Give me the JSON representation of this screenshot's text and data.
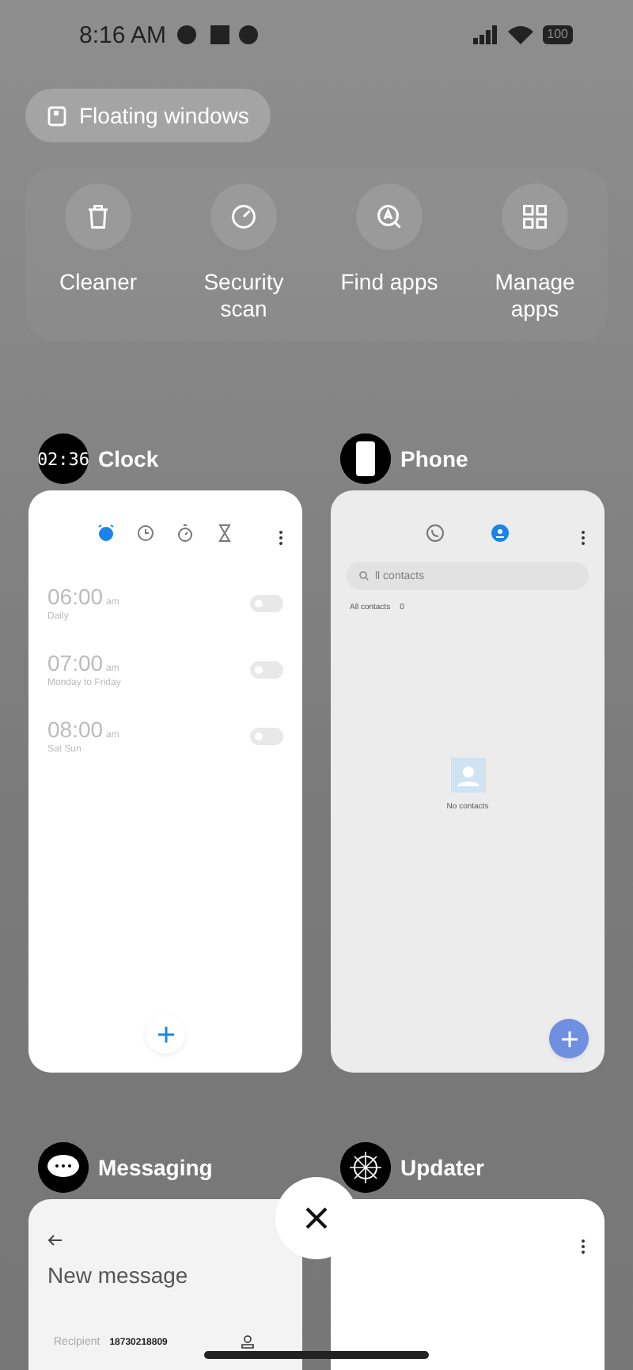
{
  "status_bar": {
    "time": "8:16 AM",
    "battery": "100"
  },
  "floating_button": {
    "label": "Floating windows"
  },
  "quick_actions": [
    {
      "label": "Cleaner",
      "kind": "trash"
    },
    {
      "label": "Security scan",
      "kind": "gauge"
    },
    {
      "label": "Find apps",
      "kind": "find"
    },
    {
      "label": "Manage apps",
      "kind": "grid"
    }
  ],
  "recent_apps": [
    {
      "kind": "clock",
      "name": "Clock",
      "icon_text": "02:36",
      "tabs": [
        {
          "kind": "alarm",
          "selected": true
        },
        {
          "kind": "clock",
          "selected": false
        },
        {
          "kind": "stopwatch",
          "selected": false
        },
        {
          "kind": "timer",
          "selected": false
        }
      ],
      "alarms": [
        {
          "time": "06:00",
          "suffix": "am",
          "repeat": "Daily",
          "on": false
        },
        {
          "time": "07:00",
          "suffix": "am",
          "repeat": "Monday to Friday",
          "on": false
        },
        {
          "time": "08:00",
          "suffix": "am",
          "repeat": "Sat Sun",
          "on": false
        }
      ]
    },
    {
      "kind": "phone",
      "name": "Phone",
      "tabs": [
        {
          "kind": "recents",
          "selected": false
        },
        {
          "kind": "contacts",
          "selected": true
        }
      ],
      "search": {
        "placeholder": "ll contacts"
      },
      "filter": "All contacts",
      "count": "0",
      "empty": "No contacts"
    },
    {
      "kind": "messaging",
      "name": "Messaging",
      "title": "New message",
      "recipient_label": "Recipient",
      "recipient": "18730218809"
    },
    {
      "kind": "updater",
      "name": "Updater"
    }
  ]
}
